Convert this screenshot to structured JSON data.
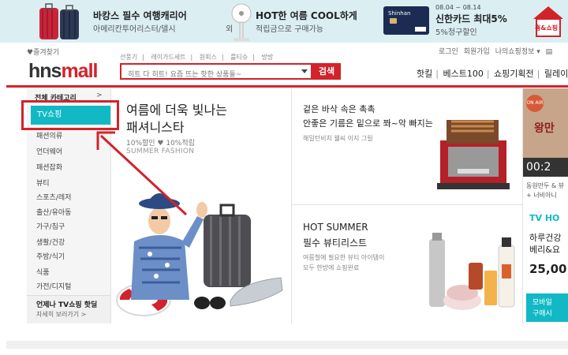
{
  "top_ads": [
    {
      "title": "바캉스 필수 여행캐리어",
      "subtitle": "아메리칸투어리스터/델시                    외"
    },
    {
      "title": "HOT한 여름 COOL하게",
      "subtitle": "적립금으로 구매가능"
    },
    {
      "card_brand": "Shinhan",
      "dates": "08.04 ~ 08.14",
      "title": "신한카드 최대5%",
      "subtitle": "5%청구할인"
    },
    {
      "label": "홈&쇼핑"
    }
  ],
  "header": {
    "favorite": "♥즐겨찾기",
    "top_links": [
      "로그인",
      "회원가입",
      "나의쇼핑정보 ▾",
      " "
    ],
    "logo_main": "hns",
    "logo_accent": "mall",
    "quick_links": [
      "선풍기",
      "레이가드세트",
      "원피스",
      "룰티슈",
      "방방"
    ],
    "search_placeholder": "히트 다 히트! 요즘 뜨는 핫한 상품들~",
    "search_button": "검색",
    "gnb": [
      "핫킬",
      "베스트100",
      "쇼핑기획전",
      "릴레이팡팡"
    ]
  },
  "sidebar": {
    "header": "전체 카테고리",
    "chevron": ">",
    "active": "TV쇼핑",
    "items": [
      "패션의류",
      "언더웨어",
      "패션잡화",
      "뷰티",
      "스포츠/레저",
      "출산/유아동",
      "가구/침구",
      "생활/건강",
      "주방/식기",
      "식품",
      "가전/디지털"
    ],
    "footer_title": "언제나 TV쇼핑 핫딜",
    "footer_link": "자세히 보러가기 >"
  },
  "main_banner": {
    "line1": "여름에 더욱 빛나는",
    "line2": "패셔니스타",
    "promo": "10%할인 ♥ 10%적립",
    "tag": "SUMMER FASHION"
  },
  "right_banners": [
    {
      "title1": "겉은 바삭 속은 촉촉",
      "title2": "안좋은 기름은 밑으로 쫘~악 빠지는",
      "sub": "해밀턴비치 웰씨 이지 그릴"
    },
    {
      "title1": "HOT SUMMER",
      "title2": "필수 뷰티리스트",
      "sub1": "여름철에 필요한 뷰티 아이템이",
      "sub2": "모두 한방에 쇼핑완료"
    }
  ],
  "far_right": {
    "badge": "ON AIR",
    "timer": "00:2",
    "line1": "동원만두 & 뷰",
    "line2": "+ 너비아니",
    "tv_label": "TV HO",
    "promo1": "하루건강",
    "promo2": "베리&요",
    "price": "25,00",
    "mobile1": "모바일",
    "mobile2": "구매시",
    "product_title": "왕만"
  },
  "colors": {
    "brand_red": "#d2232a",
    "tv_teal": "#12b9c5"
  }
}
